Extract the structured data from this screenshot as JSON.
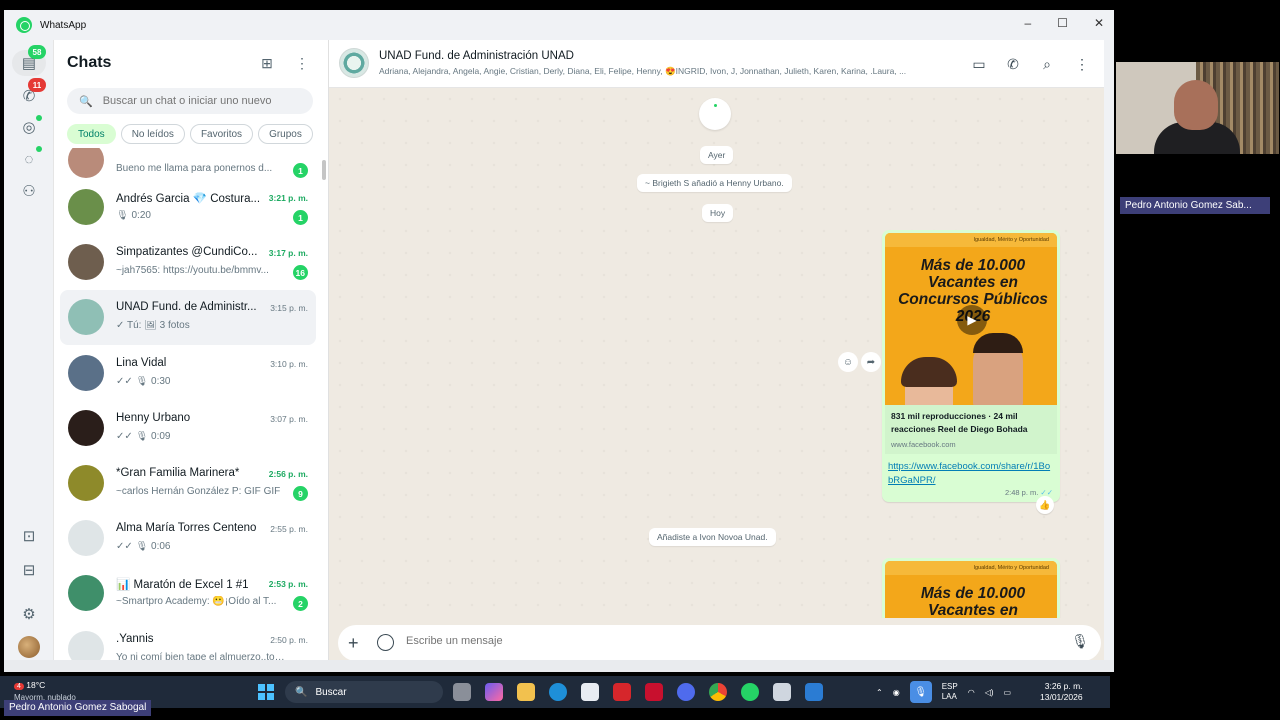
{
  "window": {
    "title": "WhatsApp",
    "controls": {
      "minimize": "–",
      "maximize": "☐",
      "close": "✕"
    }
  },
  "rail": {
    "chats_badge": "58",
    "calls_badge": "11"
  },
  "chat_list": {
    "title": "Chats",
    "search_placeholder": "Buscar un chat o iniciar uno nuevo",
    "filters": [
      "Todos",
      "No leídos",
      "Favoritos",
      "Grupos"
    ],
    "chats": [
      {
        "name": "",
        "time": "",
        "preview": "Bueno  me llama   para ponernos d...",
        "badge": "1",
        "unread": true,
        "avatar": "#b98b7a"
      },
      {
        "name": "Andrés Garcia 💎 Costura...",
        "time": "3:21 p. m.",
        "preview": "🎙 0:20",
        "badge": "1",
        "unread": true,
        "avatar": "#6a8f4a"
      },
      {
        "name": "Simpatizantes @CundiCo...",
        "time": "3:17 p. m.",
        "preview": "~jah7565: https://youtu.be/bmmv...",
        "badge": "16",
        "unread": true,
        "avatar": "#6e5e4e"
      },
      {
        "name": "UNAD Fund. de Administr...",
        "time": "3:15 p. m.",
        "preview": "✓ Tú: 🖼 3 fotos",
        "badge": "",
        "unread": false,
        "avatar": "#8fbfb5"
      },
      {
        "name": "Lina Vidal",
        "time": "3:10 p. m.",
        "preview": "✓✓ 🎙 0:30",
        "badge": "",
        "unread": false,
        "avatar": "#5a7088"
      },
      {
        "name": "Henny Urbano",
        "time": "3:07 p. m.",
        "preview": "✓✓ 🎙 0:09",
        "badge": "",
        "unread": false,
        "avatar": "#2a1e1a"
      },
      {
        "name": "*Gran Familia Marinera*",
        "time": "2:56 p. m.",
        "preview": "~carlos Hernán González P: GIF GIF",
        "badge": "9",
        "unread": true,
        "avatar": "#8e8a2a"
      },
      {
        "name": "Alma María Torres Centeno",
        "time": "2:55 p. m.",
        "preview": "✓✓ 🎙 0:06",
        "badge": "",
        "unread": false,
        "avatar": "#dfe5e7"
      },
      {
        "name": "📊 Maratón de Excel 1 #1",
        "time": "2:53 p. m.",
        "preview": "~Smartpro Academy: 😬¡Oído al T...",
        "badge": "2",
        "unread": true,
        "avatar": "#3f8f6a"
      },
      {
        "name": ".Yannis",
        "time": "2:50 p. m.",
        "preview": "Yo ni comí bien tape el almuerzo..tomé...",
        "badge": "",
        "unread": false,
        "avatar": "#dfe5e7"
      }
    ]
  },
  "conversation": {
    "name": "UNAD Fund. de Administración UNAD",
    "members": "Adriana, Alejandra, Angela, Angie, Cristian, Derly, Diana, Eli, Felipe, Henny, 😍INGRID, Ivon, J, Jonnathan, Julieth, Karen, Karina, .Laura, ...",
    "system": {
      "yesterday": "Ayer",
      "added": "~ Brigieth S añadió a Henny Urbano.",
      "today": "Hoy",
      "you_added": "Añadiste a Ivon Novoa Unad."
    },
    "message": {
      "thumb_topline": "Igualdad, Mérito y Oportunidad",
      "headline": "Más de 10.000 Vacantes en Concursos Públicos 2026",
      "link_title": "831 mil reproducciones · 24 mil reacciones Reel de Diego Bohada",
      "link_domain": "www.facebook.com",
      "url": "https://www.facebook.com/share/r/1BobRGaNPR/",
      "time": "2:48 p. m.",
      "reaction": "👍"
    },
    "message2": {
      "headline": "Más de 10.000 Vacantes en"
    },
    "composer_placeholder": "Escribe un mensaje"
  },
  "video_call": {
    "participant": "Pedro Antonio Gomez Sab..."
  },
  "taskbar": {
    "temperature": "18°C",
    "weather": "Mayorm. nublado",
    "weather_badge": "4",
    "search_label": "Buscar",
    "language": "ESP",
    "layout": "LAA",
    "time": "3:26 p. m.",
    "date": "13/01/2026"
  },
  "presenter_label": "Pedro Antonio Gomez Sabogal"
}
